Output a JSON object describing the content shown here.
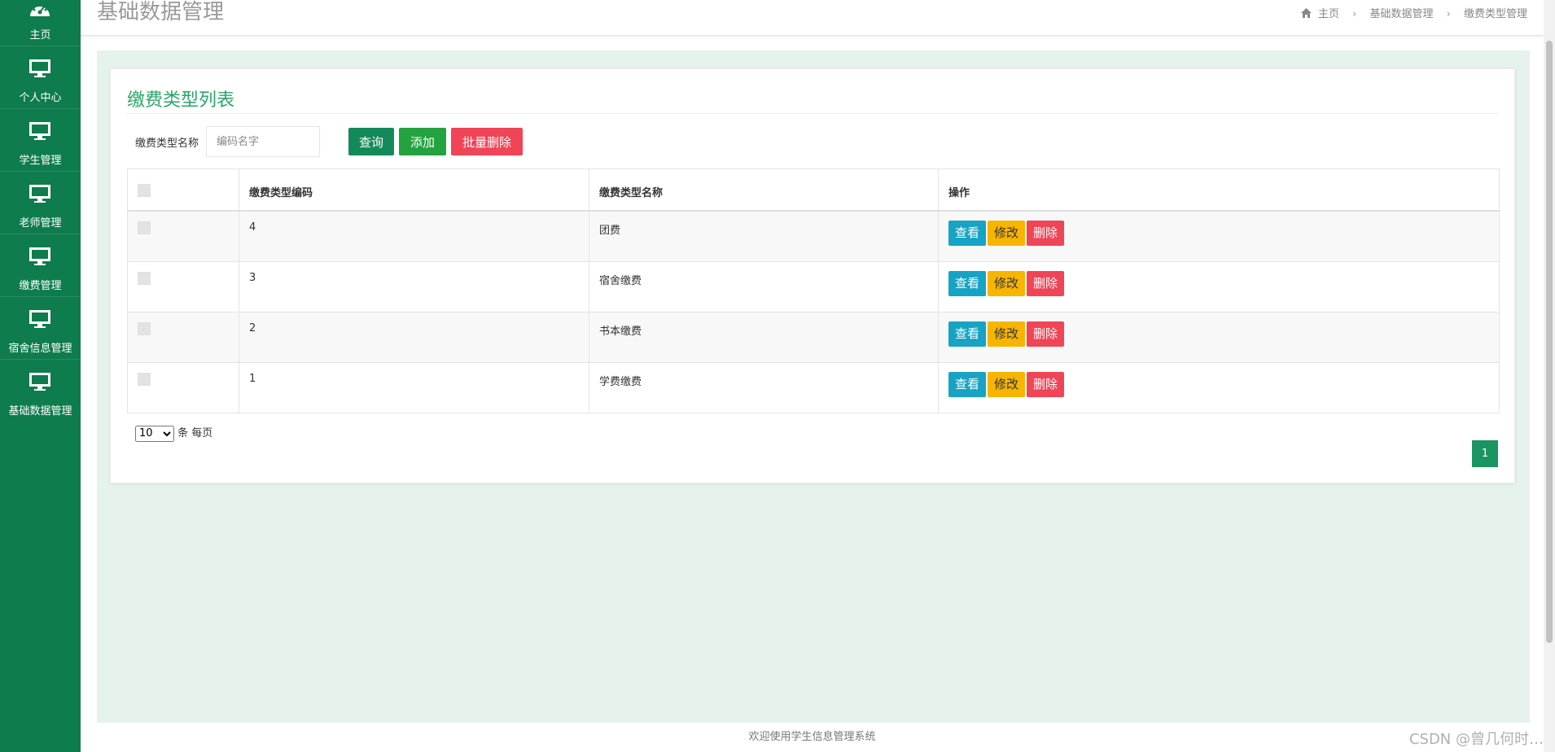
{
  "sidebar": {
    "items": [
      {
        "label": "主页",
        "icon": "dashboard-icon"
      },
      {
        "label": "个人中心",
        "icon": "monitor-icon"
      },
      {
        "label": "学生管理",
        "icon": "monitor-icon"
      },
      {
        "label": "老师管理",
        "icon": "monitor-icon"
      },
      {
        "label": "缴费管理",
        "icon": "monitor-icon"
      },
      {
        "label": "宿舍信息管理",
        "icon": "monitor-icon"
      },
      {
        "label": "基础数据管理",
        "icon": "monitor-icon"
      }
    ]
  },
  "header": {
    "title": "基础数据管理",
    "breadcrumb": [
      "主页",
      "基础数据管理",
      "缴费类型管理"
    ]
  },
  "card": {
    "title": "缴费类型列表",
    "search_label": "缴费类型名称",
    "search_placeholder": "编码名字",
    "query_label": "查询",
    "add_label": "添加",
    "batch_delete_label": "批量删除"
  },
  "table": {
    "headers": [
      "",
      "缴费类型编码",
      "缴费类型名称",
      "操作"
    ],
    "rows": [
      {
        "code": "4",
        "name": "团费"
      },
      {
        "code": "3",
        "name": "宿舍缴费"
      },
      {
        "code": "2",
        "name": "书本缴费"
      },
      {
        "code": "1",
        "name": "学费缴费"
      }
    ],
    "actions": {
      "view": "查看",
      "edit": "修改",
      "delete": "删除"
    }
  },
  "pager": {
    "page_size": "10",
    "page_size_suffix": "条 每页",
    "current_page": "1"
  },
  "footer": {
    "text": "欢迎使用学生信息管理系统",
    "watermark": "CSDN @曾几何时…"
  },
  "colors": {
    "sidebar_bg": "#0e7c4d",
    "accent": "#2aa668",
    "danger": "#f04457",
    "warning": "#f7b500",
    "info": "#17a3c4"
  }
}
